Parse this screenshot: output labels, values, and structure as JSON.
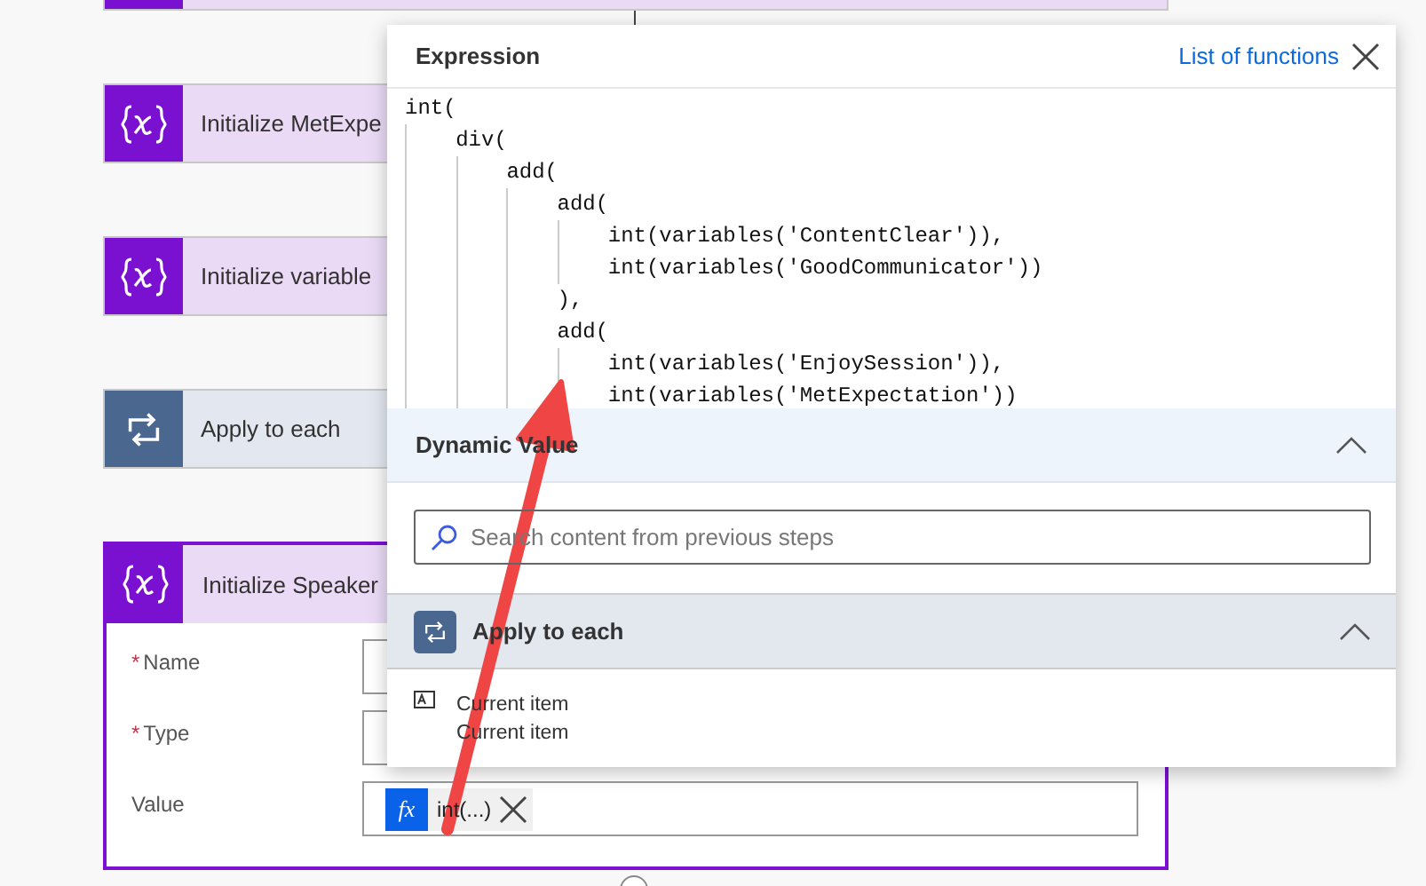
{
  "cards": [
    {
      "kind": "variable",
      "title": "Initialize MetExpe"
    },
    {
      "kind": "variable",
      "title": "Initialize variable"
    },
    {
      "kind": "loop",
      "title": "Apply to each"
    }
  ],
  "speaker_card": {
    "kind": "variable",
    "title": "Initialize Speaker",
    "selected": true,
    "required_mark": "*",
    "fields": [
      {
        "label": "Name",
        "required": true
      },
      {
        "label": "Type",
        "required": true
      },
      {
        "label": "Value",
        "required": false,
        "token": {
          "icon": "fx",
          "label": "int(...)"
        }
      }
    ]
  },
  "expression": {
    "title": "Expression",
    "link": "List of functions",
    "code": [
      {
        "text": "int(",
        "children": [
          {
            "text": "div(",
            "children": [
              {
                "text": "add(",
                "children": [
                  {
                    "text": "add(",
                    "children": [
                      {
                        "text": "int(variables('ContentClear')),"
                      },
                      {
                        "text": "int(variables('GoodCommunicator'))"
                      }
                    ]
                  },
                  {
                    "text": "),"
                  },
                  {
                    "text": "add(",
                    "children": [
                      {
                        "text": "int(variables('EnjoySession')),"
                      },
                      {
                        "text": "int(variables('MetExpectation'))"
                      }
                    ]
                  }
                ]
              }
            ]
          }
        ]
      }
    ]
  },
  "dynamic": {
    "title": "Dynamic Value",
    "expanded": true,
    "search": {
      "placeholder": "Search content from previous steps"
    },
    "groups": [
      {
        "title": "Apply to each",
        "kind": "loop",
        "expanded": true,
        "items": [
          {
            "name": "Current item",
            "description": "Current item"
          }
        ]
      }
    ]
  }
}
